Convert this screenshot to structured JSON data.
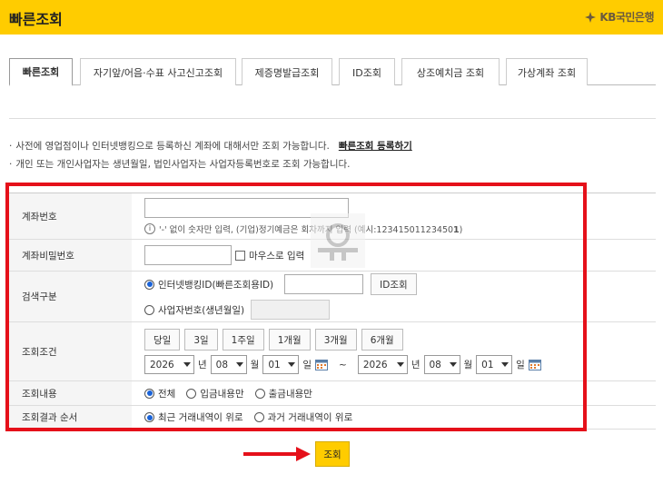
{
  "header": {
    "title": "빠른조회",
    "brand": "KB국민은행"
  },
  "tabs": [
    {
      "label": "빠른조회",
      "active": true
    },
    {
      "label": "자기앞/어음·수표 사고신고조회",
      "active": false
    },
    {
      "label": "제증명발급조회",
      "active": false
    },
    {
      "label": "ID조회",
      "active": false
    },
    {
      "label": "상조예치금 조회",
      "active": false
    },
    {
      "label": "가상계좌 조회",
      "active": false
    }
  ],
  "notes": {
    "line1": "사전에 영업점이나 인터넷뱅킹으로 등록하신 계좌에 대해서만 조회 가능합니다.",
    "link": "빠른조회 등록하기",
    "line2": "개인 또는 개인사업자는 생년월일, 법인사업자는 사업자등록번호로 조회 가능합니다."
  },
  "form": {
    "account": {
      "label": "계좌번호",
      "value": "",
      "hint": "'-' 없이 숫자만 입력, (기업)정기예금은 회차까지 입력 (예시:12341501123450",
      "hint_bold": "1",
      "hint_end": ")"
    },
    "password": {
      "label": "계좌비밀번호",
      "value": "",
      "mouse_label": "마우스로 입력"
    },
    "search_type": {
      "label": "검색구분",
      "opt1": "인터넷뱅킹ID(빠른조회용ID)",
      "opt2": "사업자번호(생년월일)",
      "id_button": "ID조회"
    },
    "period": {
      "label": "조회조건",
      "quick": [
        "당일",
        "3일",
        "1주일",
        "1개월",
        "3개월",
        "6개월"
      ],
      "from": {
        "year": "2026",
        "month": "08",
        "day": "01"
      },
      "to": {
        "year": "2026",
        "month": "08",
        "day": "01"
      },
      "unit_year": "년",
      "unit_month": "월",
      "unit_day": "일",
      "tilde": "~"
    },
    "content": {
      "label": "조회내용",
      "opts": [
        "전체",
        "입금내용만",
        "출금내용만"
      ],
      "selected": 0
    },
    "order": {
      "label": "조회결과 순서",
      "opts": [
        "최근 거래내역이 위로",
        "과거 거래내역이 위로"
      ],
      "selected": 0
    }
  },
  "submit": "조회",
  "colors": {
    "brand_yellow": "#ffcc00",
    "highlight_red": "#e5101a",
    "radio_blue": "#1a63d8"
  }
}
